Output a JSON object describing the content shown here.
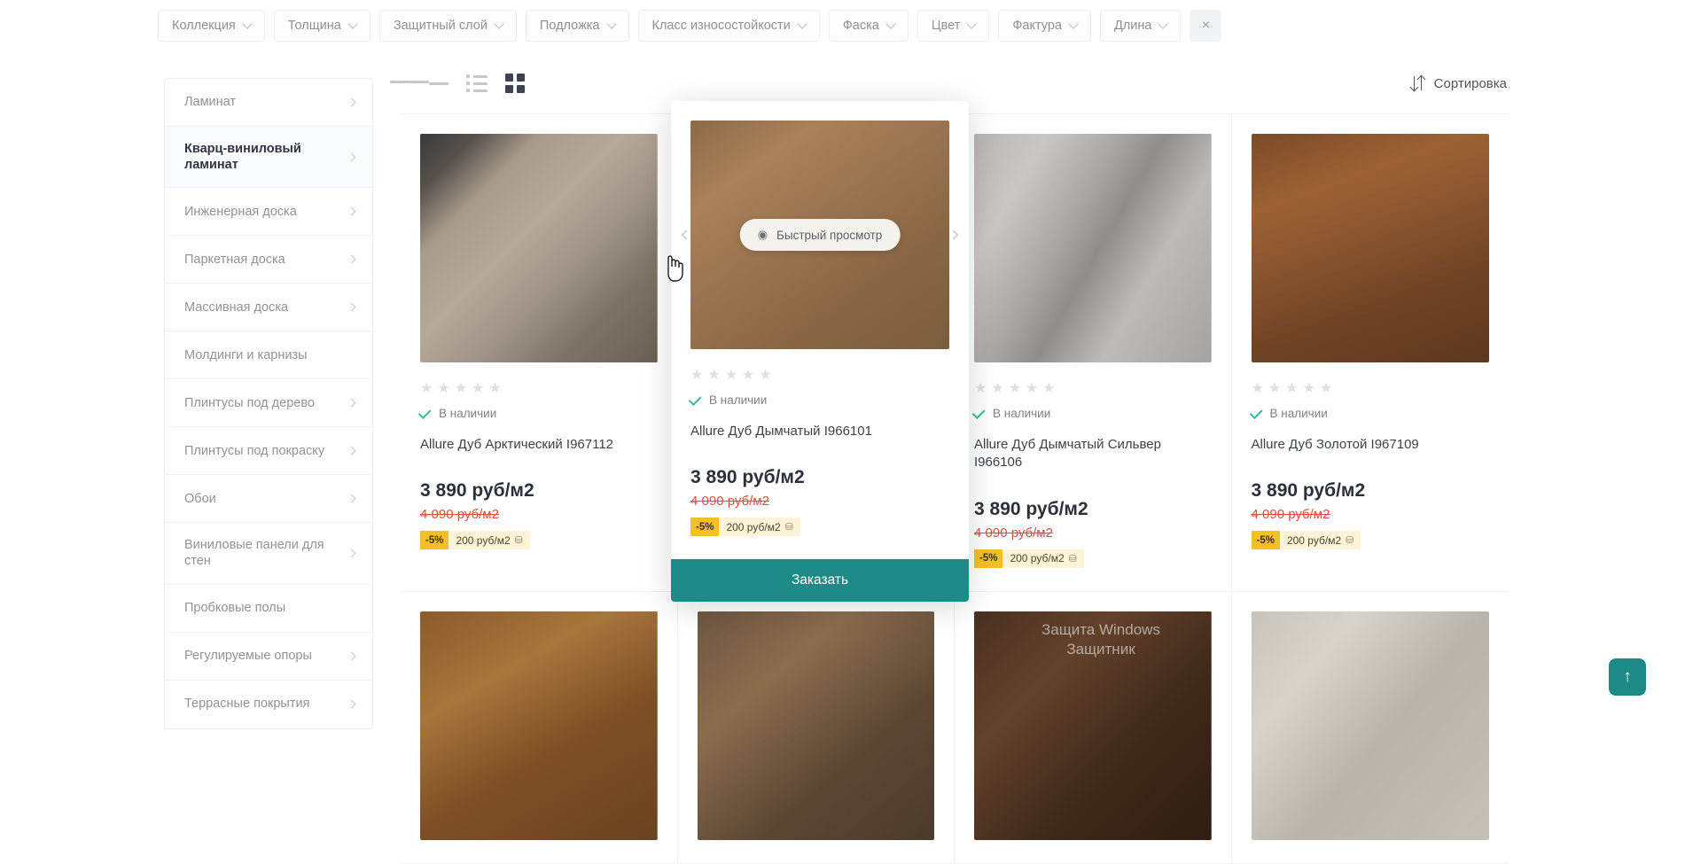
{
  "filters": {
    "chips": [
      {
        "label": "Коллекция"
      },
      {
        "label": "Толщина"
      },
      {
        "label": "Защитный слой"
      },
      {
        "label": "Подложка"
      },
      {
        "label": "Класс износостойкости"
      },
      {
        "label": "Фаска"
      },
      {
        "label": "Цвет"
      },
      {
        "label": "Фактура"
      },
      {
        "label": "Длина"
      }
    ],
    "close_label": "×"
  },
  "sidebar": {
    "items": [
      {
        "label": "Ламинат",
        "chevron": true,
        "active": false
      },
      {
        "label": "Кварц-виниловый ламинат",
        "chevron": true,
        "active": true
      },
      {
        "label": "Инженерная доска",
        "chevron": true,
        "active": false
      },
      {
        "label": "Паркетная доска",
        "chevron": true,
        "active": false
      },
      {
        "label": "Массивная доска",
        "chevron": true,
        "active": false
      },
      {
        "label": "Молдинги и карнизы",
        "chevron": false,
        "active": false
      },
      {
        "label": "Плинтусы под дерево",
        "chevron": true,
        "active": false
      },
      {
        "label": "Плинтусы под покраску",
        "chevron": true,
        "active": false
      },
      {
        "label": "Обои",
        "chevron": true,
        "active": false
      },
      {
        "label": "Виниловые панели для стен",
        "chevron": true,
        "active": false
      },
      {
        "label": "Пробковые полы",
        "chevron": false,
        "active": false
      },
      {
        "label": "Регулируемые опоры",
        "chevron": true,
        "active": false
      },
      {
        "label": "Террасные покрытия",
        "chevron": true,
        "active": false
      }
    ]
  },
  "toolbar": {
    "view_modes": [
      "list-view",
      "detailed-list-view",
      "grid-view"
    ],
    "active_view": "grid-view",
    "sort_label": "Сортировка"
  },
  "products": [
    {
      "name": "Allure Дуб Арктический I967112",
      "stock": "В наличии",
      "rating": 0,
      "price": "3 890 руб/м2",
      "old_price": "4 090 руб/м2",
      "discount": "-5%",
      "saving": "200 руб/м2",
      "photo": "grey-oak-floor-with-chairs"
    },
    {
      "name": "Allure Дуб Дымчатый I966101",
      "stock": "В наличии",
      "rating": 0,
      "price": "3 890 руб/м2",
      "old_price": "4 090 руб/м2",
      "discount": "-5%",
      "saving": "200 руб/м2",
      "photo": "brown-oak-floor-with-table"
    },
    {
      "name": "Allure Дуб Дымчатый Сильвер I966106",
      "stock": "В наличии",
      "rating": 0,
      "price": "3 890 руб/м2",
      "old_price": "4 090 руб/м2",
      "discount": "-5%",
      "saving": "200 руб/м2",
      "photo": "grey-plank-floor-with-black-frame"
    },
    {
      "name": "Allure Дуб Золотой I967109",
      "stock": "В наличии",
      "rating": 0,
      "price": "3 890 руб/м2",
      "old_price": "4 090 руб/м2",
      "discount": "-5%",
      "saving": "200 руб/м2",
      "photo": "dark-oak-floor-with-copper-pipe"
    }
  ],
  "popup": {
    "quick_view_label": "Быстрый просмотр",
    "order_label": "Заказать",
    "name": "Allure Дуб Дымчатый I966101",
    "stock": "В наличии",
    "price": "3 890 руб/м2",
    "old_price": "4 090 руб/м2",
    "discount": "-5%",
    "saving": "200 руб/м2"
  },
  "icons": {
    "eye": "◉",
    "tag": "⛁",
    "arrow_up": "↑",
    "star": "★"
  },
  "watermark": "Защита Windows\nЗащитник",
  "colors": {
    "accent_teal": "#1e8a87",
    "badge_yellow": "#f5c026",
    "badge_yellow_light": "#fdf4d6",
    "old_price_red": "#e04b3f",
    "in_stock_green": "#2fbf9a"
  }
}
